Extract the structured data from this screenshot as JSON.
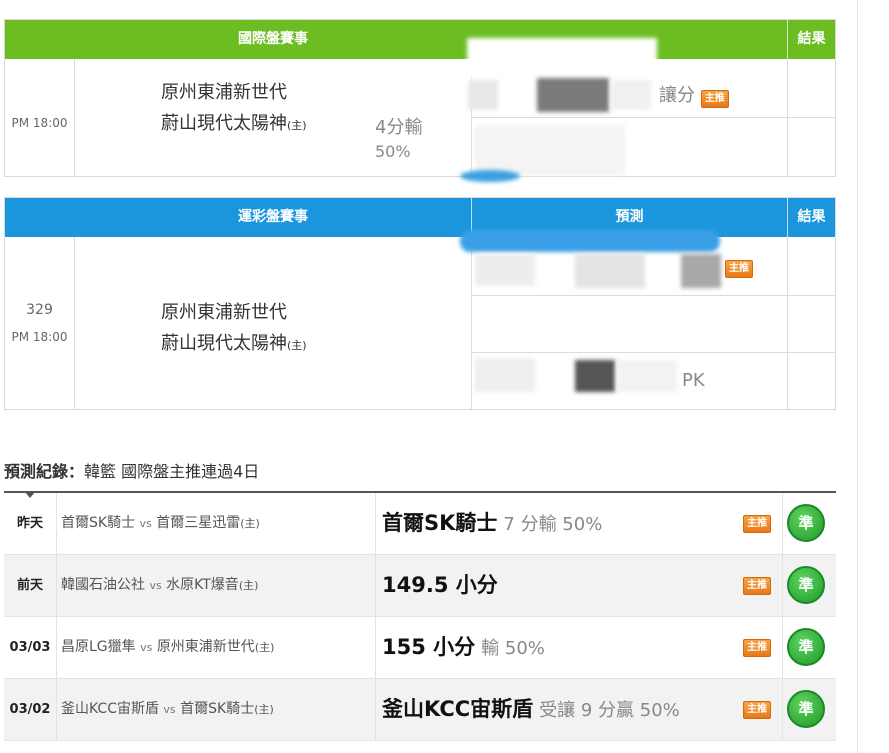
{
  "intl": {
    "header": "國際盤賽事",
    "result_header": "結果",
    "time": "PM 18:00",
    "home": "原州東浦新世代",
    "away": "蔚山現代太陽神",
    "home_mark": "(主)",
    "odds_line": "4分輸",
    "odds_pct": "50%",
    "pred_text": "讓分",
    "badge": "主推"
  },
  "lottery": {
    "header": "運彩盤賽事",
    "pred_header": "預測",
    "result_header": "結果",
    "number": "329",
    "time": "PM 18:00",
    "home": "原州東浦新世代",
    "away": "蔚山現代太陽神",
    "home_mark": "(主)",
    "badge": "主推",
    "pred_row3_text": "PK"
  },
  "record": {
    "label": "預測紀錄",
    "colon": "：",
    "summary": "韓籃 國際盤主推連過4日",
    "rows": [
      {
        "day": "昨天",
        "home": "首爾SK騎士",
        "vs": "vs",
        "away": "首爾三星迅雷",
        "mark": "(主)",
        "pick": "首爾SK騎士",
        "detail": "7 分輸 50%",
        "badge": "主推",
        "result": "準"
      },
      {
        "day": "前天",
        "home": "韓國石油公社",
        "vs": "vs",
        "away": "水原KT爆音",
        "mark": "(主)",
        "pick": "149.5 小分",
        "detail": "",
        "badge": "主推",
        "result": "準"
      },
      {
        "day": "03/03",
        "home": "昌原LG獵隼",
        "vs": "vs",
        "away": "原州東浦新世代",
        "mark": "(主)",
        "pick": "155 小分",
        "detail": "輸 50%",
        "badge": "主推",
        "result": "準"
      },
      {
        "day": "03/02",
        "home": "釜山KCC宙斯盾",
        "vs": "vs",
        "away": "首爾SK騎士",
        "mark": "(主)",
        "pick": "釜山KCC宙斯盾",
        "detail": "受讓 9 分贏 50%",
        "badge": "主推",
        "result": "準"
      }
    ]
  },
  "colors": {
    "intl_header": "#6bbd22",
    "lottery_header": "#1b96dc",
    "badge": "#f08c26",
    "check": "#2aa836"
  }
}
